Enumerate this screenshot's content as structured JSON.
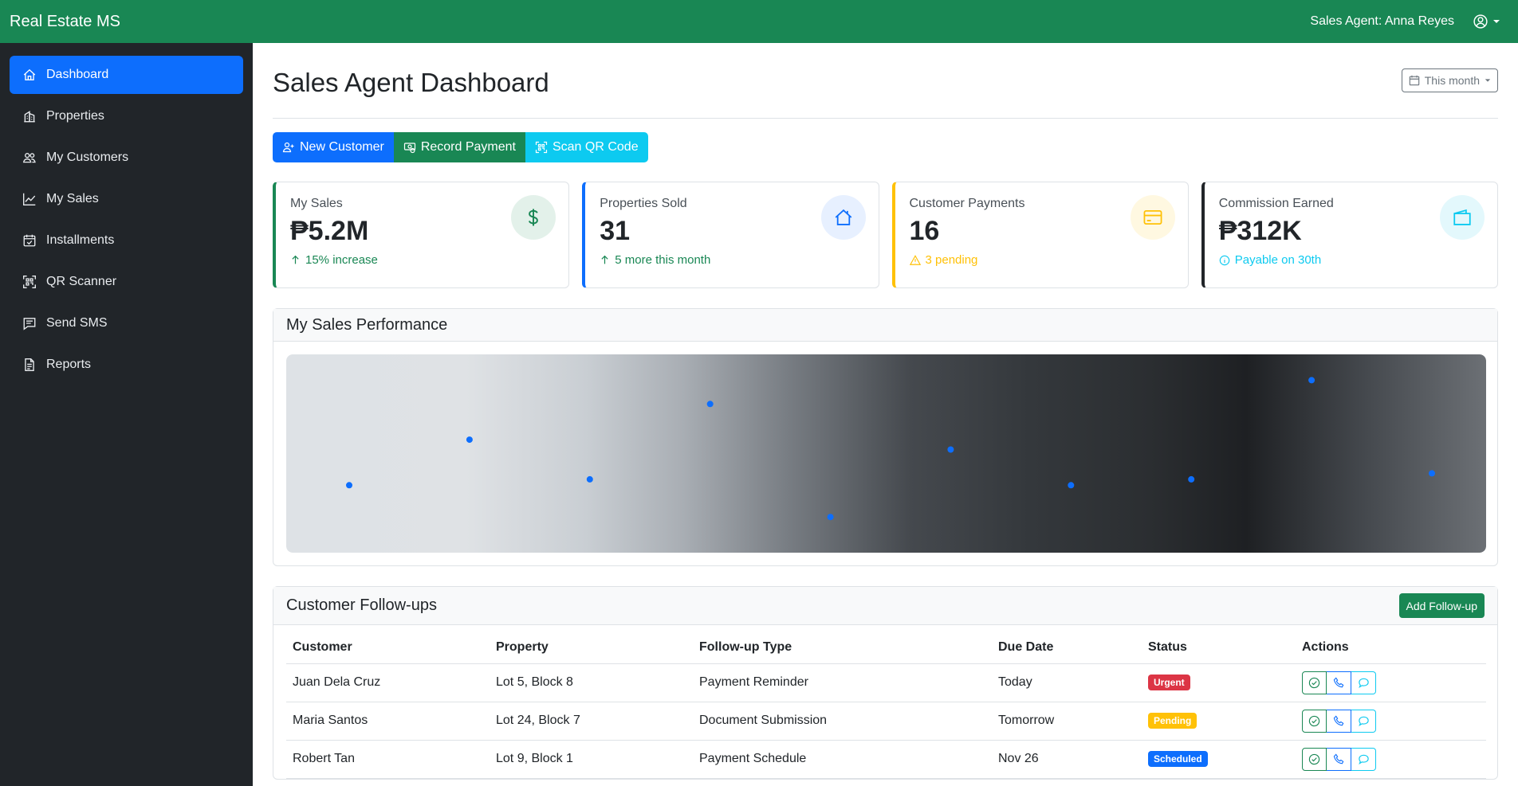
{
  "app": {
    "brand": "Real Estate MS",
    "user_label": "Sales Agent: Anna Reyes"
  },
  "sidebar": {
    "items": [
      {
        "label": "Dashboard",
        "icon": "house-icon"
      },
      {
        "label": "Properties",
        "icon": "building-icon"
      },
      {
        "label": "My Customers",
        "icon": "people-icon"
      },
      {
        "label": "My Sales",
        "icon": "graph-up-icon"
      },
      {
        "label": "Installments",
        "icon": "calendar-check-icon"
      },
      {
        "label": "QR Scanner",
        "icon": "qr-scan-icon"
      },
      {
        "label": "Send SMS",
        "icon": "chat-text-icon"
      },
      {
        "label": "Reports",
        "icon": "file-text-icon"
      }
    ],
    "active_index": 0
  },
  "header": {
    "title": "Sales Agent Dashboard",
    "period": "This month"
  },
  "actions": {
    "new_customer": "New Customer",
    "record_payment": "Record Payment",
    "scan_qr": "Scan QR Code"
  },
  "cards": [
    {
      "label": "My Sales",
      "value": "₱5.2M",
      "sub": "15% increase",
      "color": "#198754",
      "icon": "dollar-icon"
    },
    {
      "label": "Properties Sold",
      "value": "31",
      "sub": "5 more this month",
      "color": "#198754",
      "icon": "house-icon"
    },
    {
      "label": "Customer Payments",
      "value": "16",
      "sub": "3 pending",
      "color": "#ffc107",
      "icon": "credit-card-icon"
    },
    {
      "label": "Commission Earned",
      "value": "₱312K",
      "sub": "Payable on 30th",
      "color": "#0dcaf0",
      "icon": "wallet-icon"
    }
  ],
  "performance": {
    "title": "My Sales Performance"
  },
  "chart_data": {
    "type": "scatter",
    "x": [
      1,
      2,
      3,
      4,
      5,
      6,
      7,
      8,
      9,
      10
    ],
    "series": [
      {
        "values": [
          34,
          57,
          37,
          75,
          18,
          52,
          34,
          37,
          87,
          40
        ]
      }
    ],
    "ylim": [
      0,
      100
    ],
    "title": "",
    "xlabel": "",
    "ylabel": "",
    "grid": false,
    "point_color": "#0d6efd"
  },
  "followups": {
    "title": "Customer Follow-ups",
    "add_label": "Add Follow-up",
    "columns": [
      "Customer",
      "Property",
      "Follow-up Type",
      "Due Date",
      "Status",
      "Actions"
    ],
    "rows": [
      {
        "customer": "Juan Dela Cruz",
        "property": "Lot 5, Block 8",
        "type": "Payment Reminder",
        "due": "Today",
        "status": "Urgent",
        "status_color": "#dc3545"
      },
      {
        "customer": "Maria Santos",
        "property": "Lot 24, Block 7",
        "type": "Document Submission",
        "due": "Tomorrow",
        "status": "Pending",
        "status_color": "#ffc107"
      },
      {
        "customer": "Robert Tan",
        "property": "Lot 9, Block 1",
        "type": "Payment Schedule",
        "due": "Nov 26",
        "status": "Scheduled",
        "status_color": "#0d6efd"
      }
    ]
  }
}
